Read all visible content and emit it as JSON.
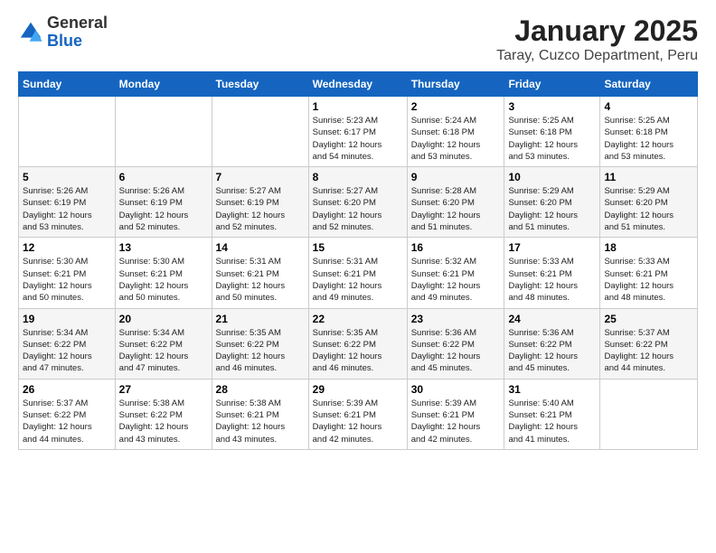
{
  "logo": {
    "general": "General",
    "blue": "Blue"
  },
  "title": "January 2025",
  "subtitle": "Taray, Cuzco Department, Peru",
  "weekdays": [
    "Sunday",
    "Monday",
    "Tuesday",
    "Wednesday",
    "Thursday",
    "Friday",
    "Saturday"
  ],
  "weeks": [
    [
      {
        "day": "",
        "info": ""
      },
      {
        "day": "",
        "info": ""
      },
      {
        "day": "",
        "info": ""
      },
      {
        "day": "1",
        "info": "Sunrise: 5:23 AM\nSunset: 6:17 PM\nDaylight: 12 hours\nand 54 minutes."
      },
      {
        "day": "2",
        "info": "Sunrise: 5:24 AM\nSunset: 6:18 PM\nDaylight: 12 hours\nand 53 minutes."
      },
      {
        "day": "3",
        "info": "Sunrise: 5:25 AM\nSunset: 6:18 PM\nDaylight: 12 hours\nand 53 minutes."
      },
      {
        "day": "4",
        "info": "Sunrise: 5:25 AM\nSunset: 6:18 PM\nDaylight: 12 hours\nand 53 minutes."
      }
    ],
    [
      {
        "day": "5",
        "info": "Sunrise: 5:26 AM\nSunset: 6:19 PM\nDaylight: 12 hours\nand 53 minutes."
      },
      {
        "day": "6",
        "info": "Sunrise: 5:26 AM\nSunset: 6:19 PM\nDaylight: 12 hours\nand 52 minutes."
      },
      {
        "day": "7",
        "info": "Sunrise: 5:27 AM\nSunset: 6:19 PM\nDaylight: 12 hours\nand 52 minutes."
      },
      {
        "day": "8",
        "info": "Sunrise: 5:27 AM\nSunset: 6:20 PM\nDaylight: 12 hours\nand 52 minutes."
      },
      {
        "day": "9",
        "info": "Sunrise: 5:28 AM\nSunset: 6:20 PM\nDaylight: 12 hours\nand 51 minutes."
      },
      {
        "day": "10",
        "info": "Sunrise: 5:29 AM\nSunset: 6:20 PM\nDaylight: 12 hours\nand 51 minutes."
      },
      {
        "day": "11",
        "info": "Sunrise: 5:29 AM\nSunset: 6:20 PM\nDaylight: 12 hours\nand 51 minutes."
      }
    ],
    [
      {
        "day": "12",
        "info": "Sunrise: 5:30 AM\nSunset: 6:21 PM\nDaylight: 12 hours\nand 50 minutes."
      },
      {
        "day": "13",
        "info": "Sunrise: 5:30 AM\nSunset: 6:21 PM\nDaylight: 12 hours\nand 50 minutes."
      },
      {
        "day": "14",
        "info": "Sunrise: 5:31 AM\nSunset: 6:21 PM\nDaylight: 12 hours\nand 50 minutes."
      },
      {
        "day": "15",
        "info": "Sunrise: 5:31 AM\nSunset: 6:21 PM\nDaylight: 12 hours\nand 49 minutes."
      },
      {
        "day": "16",
        "info": "Sunrise: 5:32 AM\nSunset: 6:21 PM\nDaylight: 12 hours\nand 49 minutes."
      },
      {
        "day": "17",
        "info": "Sunrise: 5:33 AM\nSunset: 6:21 PM\nDaylight: 12 hours\nand 48 minutes."
      },
      {
        "day": "18",
        "info": "Sunrise: 5:33 AM\nSunset: 6:21 PM\nDaylight: 12 hours\nand 48 minutes."
      }
    ],
    [
      {
        "day": "19",
        "info": "Sunrise: 5:34 AM\nSunset: 6:22 PM\nDaylight: 12 hours\nand 47 minutes."
      },
      {
        "day": "20",
        "info": "Sunrise: 5:34 AM\nSunset: 6:22 PM\nDaylight: 12 hours\nand 47 minutes."
      },
      {
        "day": "21",
        "info": "Sunrise: 5:35 AM\nSunset: 6:22 PM\nDaylight: 12 hours\nand 46 minutes."
      },
      {
        "day": "22",
        "info": "Sunrise: 5:35 AM\nSunset: 6:22 PM\nDaylight: 12 hours\nand 46 minutes."
      },
      {
        "day": "23",
        "info": "Sunrise: 5:36 AM\nSunset: 6:22 PM\nDaylight: 12 hours\nand 45 minutes."
      },
      {
        "day": "24",
        "info": "Sunrise: 5:36 AM\nSunset: 6:22 PM\nDaylight: 12 hours\nand 45 minutes."
      },
      {
        "day": "25",
        "info": "Sunrise: 5:37 AM\nSunset: 6:22 PM\nDaylight: 12 hours\nand 44 minutes."
      }
    ],
    [
      {
        "day": "26",
        "info": "Sunrise: 5:37 AM\nSunset: 6:22 PM\nDaylight: 12 hours\nand 44 minutes."
      },
      {
        "day": "27",
        "info": "Sunrise: 5:38 AM\nSunset: 6:22 PM\nDaylight: 12 hours\nand 43 minutes."
      },
      {
        "day": "28",
        "info": "Sunrise: 5:38 AM\nSunset: 6:21 PM\nDaylight: 12 hours\nand 43 minutes."
      },
      {
        "day": "29",
        "info": "Sunrise: 5:39 AM\nSunset: 6:21 PM\nDaylight: 12 hours\nand 42 minutes."
      },
      {
        "day": "30",
        "info": "Sunrise: 5:39 AM\nSunset: 6:21 PM\nDaylight: 12 hours\nand 42 minutes."
      },
      {
        "day": "31",
        "info": "Sunrise: 5:40 AM\nSunset: 6:21 PM\nDaylight: 12 hours\nand 41 minutes."
      },
      {
        "day": "",
        "info": ""
      }
    ]
  ]
}
